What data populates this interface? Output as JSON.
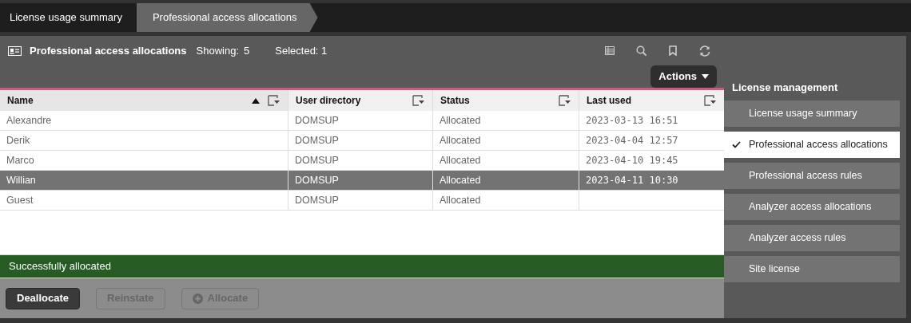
{
  "breadcrumbs": [
    {
      "label": "License usage summary",
      "selected": false
    },
    {
      "label": "Professional access allocations",
      "selected": true
    }
  ],
  "header": {
    "title": "Professional access allocations",
    "showing_label": "Showing:",
    "showing_value": "5",
    "selected_label": "Selected: 1"
  },
  "actions_button": {
    "label": "Actions"
  },
  "table": {
    "columns": [
      {
        "label": "Name",
        "sorted": true
      },
      {
        "label": "User directory",
        "sorted": false
      },
      {
        "label": "Status",
        "sorted": false
      },
      {
        "label": "Last used",
        "sorted": false
      }
    ],
    "rows": [
      {
        "selected": false,
        "cells": [
          "Alexandre",
          "DOMSUP",
          "Allocated",
          "2023-03-13 16:51"
        ]
      },
      {
        "selected": false,
        "cells": [
          "Derik",
          "DOMSUP",
          "Allocated",
          "2023-04-04 12:57"
        ]
      },
      {
        "selected": false,
        "cells": [
          "Marco",
          "DOMSUP",
          "Allocated",
          "2023-04-10 19:45"
        ]
      },
      {
        "selected": true,
        "cells": [
          "Willian",
          "DOMSUP",
          "Allocated",
          "2023-04-11 10:30"
        ]
      },
      {
        "selected": false,
        "cells": [
          "Guest",
          "DOMSUP",
          "Allocated",
          ""
        ]
      }
    ]
  },
  "message": "Successfully allocated",
  "buttons": [
    {
      "label": "Deallocate",
      "disabled": false,
      "kind": "plain"
    },
    {
      "label": "Reinstate",
      "disabled": true,
      "kind": "plain"
    },
    {
      "label": "Allocate",
      "disabled": true,
      "kind": "add"
    }
  ],
  "sidebar": {
    "title": "License management",
    "items": [
      {
        "label": "License usage summary",
        "selected": false
      },
      {
        "label": "Professional access allocations",
        "selected": true
      },
      {
        "label": "Professional access rules",
        "selected": false
      },
      {
        "label": "Analyzer access allocations",
        "selected": false
      },
      {
        "label": "Analyzer access rules",
        "selected": false
      },
      {
        "label": "Site license",
        "selected": false
      }
    ]
  }
}
